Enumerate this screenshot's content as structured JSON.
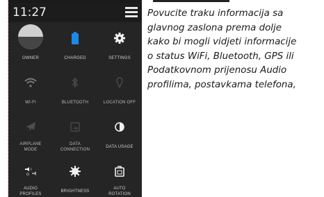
{
  "status_bar": {
    "time": "11:27"
  },
  "tiles": [
    {
      "label": "OWNER",
      "icon": "avatar-icon"
    },
    {
      "label": "CHARGED",
      "icon": "battery-icon",
      "color": "#1e88e5"
    },
    {
      "label": "SETTINGS",
      "icon": "gear-icon"
    },
    {
      "label": "WI-FI",
      "icon": "wifi-icon"
    },
    {
      "label": "BLUETOOTH",
      "icon": "bluetooth-icon"
    },
    {
      "label": "LOCATION OFF",
      "icon": "location-icon"
    },
    {
      "label": "AIRPLANE\nMODE",
      "label_line1": "AIRPLANE",
      "label_line2": "MODE",
      "icon": "airplane-icon"
    },
    {
      "label": "DATA\nCONNECTION",
      "label_line1": "DATA",
      "label_line2": "CONNECTION",
      "icon": "data-connection-icon"
    },
    {
      "label": "DATA USAGE",
      "icon": "data-usage-icon"
    },
    {
      "label": "AUDIO\nPROFILES",
      "label_line1": "AUDIO",
      "label_line2": "PROFILES",
      "icon": "audio-profiles-icon"
    },
    {
      "label": "BRIGHTNESS",
      "icon": "brightness-icon"
    },
    {
      "label": "AUTO\nROTATION",
      "label_line1": "AUTO",
      "label_line2": "ROTATION",
      "icon": "auto-rotate-icon"
    }
  ],
  "description": {
    "lines": [
      "Povucite traku informacija sa",
      "glavnog zaslona prema dolje",
      "kako bi mogli vidjeti informacije",
      "o status WiFi, Bluetooth, GPS ili",
      "Podatkovnom prijenosu Audio",
      "profilima, postavkama telefona,"
    ]
  },
  "colors": {
    "panel": "#252525",
    "accent": "#1e88e5",
    "text": "#cfcfcf"
  }
}
